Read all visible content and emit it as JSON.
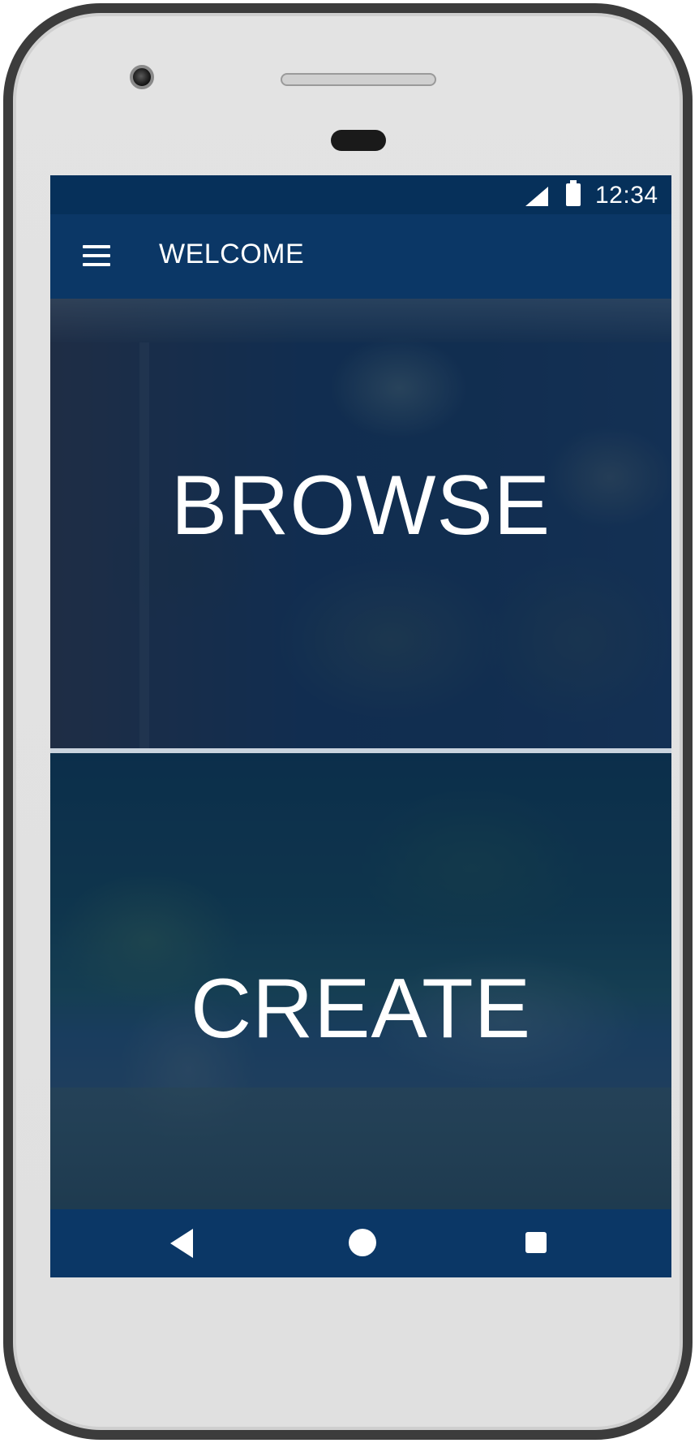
{
  "status_bar": {
    "time": "12:34",
    "signal_icon": "signal-icon",
    "battery_icon": "battery-icon"
  },
  "app_bar": {
    "menu_icon": "hamburger-menu-icon",
    "title": "WELCOME"
  },
  "tiles": [
    {
      "label": "BROWSE"
    },
    {
      "label": "CREATE"
    }
  ],
  "nav_bar": {
    "back_icon": "back-triangle-icon",
    "home_icon": "home-circle-icon",
    "recents_icon": "recents-square-icon"
  },
  "colors": {
    "primary": "#0b3766",
    "status_bar": "#06305a",
    "text": "#ffffff",
    "phone_frame": "#3c3c3c",
    "phone_body": "#e0e0e0"
  }
}
